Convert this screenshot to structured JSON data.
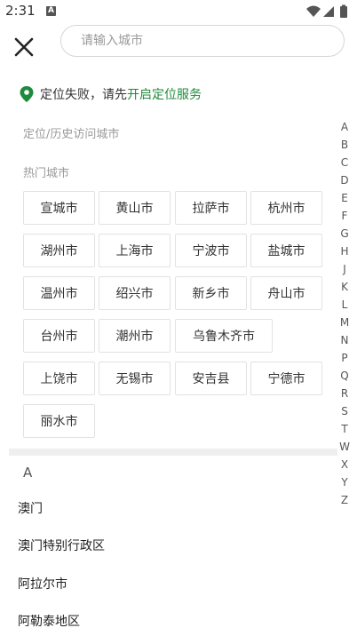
{
  "status_bar": {
    "time": "2:31",
    "notification_icon": "A",
    "icons": [
      "wifi-icon",
      "signal-icon",
      "battery-icon"
    ]
  },
  "header": {
    "close_icon": "close-icon",
    "search": {
      "placeholder": "请输入城市",
      "value": ""
    }
  },
  "location": {
    "icon": "location-pin-icon",
    "status_text": "定位失败，请先",
    "link_text": "开启定位服务",
    "link_color": "#1f8a3b"
  },
  "history_section": {
    "label": "定位/历史访问城市"
  },
  "hot_section": {
    "label": "热门城市",
    "cities": [
      "宣城市",
      "黄山市",
      "拉萨市",
      "杭州市",
      "湖州市",
      "上海市",
      "宁波市",
      "盐城市",
      "温州市",
      "绍兴市",
      "新乡市",
      "舟山市",
      "台州市",
      "潮州市",
      "乌鲁木齐市",
      "上饶市",
      "无锡市",
      "安吉县",
      "宁德市",
      "丽水市"
    ]
  },
  "city_list": {
    "group_letter": "A",
    "items": [
      "澳门",
      "澳门特别行政区",
      "阿拉尔市",
      "阿勒泰地区"
    ]
  },
  "alphabet_index": [
    "A",
    "B",
    "C",
    "D",
    "E",
    "F",
    "G",
    "H",
    "J",
    "K",
    "L",
    "M",
    "N",
    "P",
    "Q",
    "R",
    "S",
    "T",
    "W",
    "X",
    "Y",
    "Z"
  ]
}
